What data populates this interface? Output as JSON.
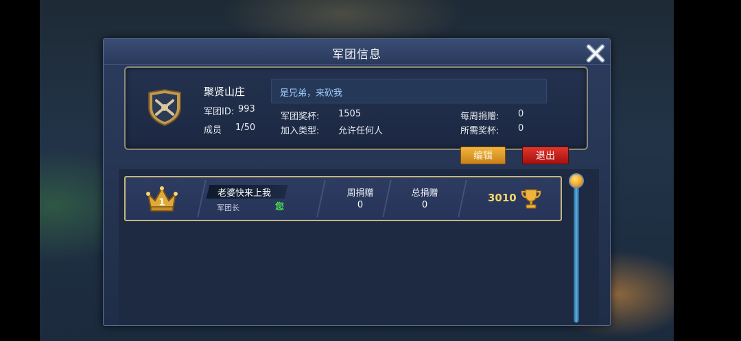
{
  "dialog": {
    "title": "军团信息"
  },
  "guild": {
    "name": "聚贤山庄",
    "id_label": "军团ID:",
    "id": "993",
    "members_label": "成员",
    "members": "1/50",
    "motto": "是兄弟，来砍我",
    "trophy_label": "军团奖杯:",
    "trophy": "1505",
    "join_type_label": "加入类型:",
    "join_type": "允许任何人",
    "weekly_donation_label": "每周捐赠:",
    "weekly_donation": "0",
    "required_trophy_label": "所需奖杯:",
    "required_trophy": "0"
  },
  "buttons": {
    "edit": "编辑",
    "quit": "退出"
  },
  "members": [
    {
      "rank": "1",
      "name": "老婆快来上我",
      "role": "军团长",
      "you_tag": "您",
      "weekly_label": "周捐赠",
      "weekly": "0",
      "total_label": "总捐赠",
      "total": "0",
      "trophies": "3010"
    }
  ],
  "colors": {
    "accent_gold": "#f7d66a",
    "edit_button": "#e0a02e",
    "quit_button": "#c8201a",
    "you_tag": "#4de34a",
    "motto_text": "#9fd0ff"
  },
  "icons": {
    "close": "close-x-icon",
    "badge": "shield-emblem-icon",
    "rank": "crown-icon",
    "trophy": "trophy-icon"
  }
}
